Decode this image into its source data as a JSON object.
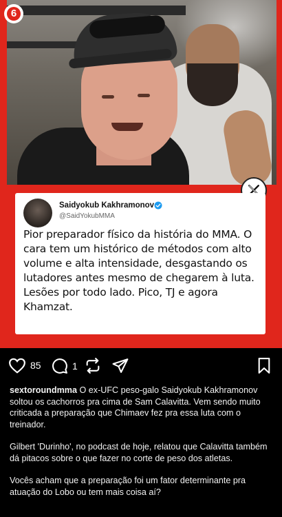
{
  "post": {
    "brand_logo_text": "6",
    "tweet": {
      "name": "Saidyokub Kakhramonov",
      "handle": "@SaidYokubMMA",
      "text": "Pior preparador físico da história do MMA. O cara tem um histórico de métodos com alto volume e alta intensidade, desgastando os lutadores antes mesmo de chegarem à luta. Lesões por todo lado. Pico, TJ e agora Khamzat."
    }
  },
  "actions": {
    "like_count": "85",
    "comment_count": "1"
  },
  "caption": {
    "username": "sextoroundmma",
    "paragraph_1": "O ex-UFC peso-galo Saidyokub Kakhramonov soltou os cachorros pra cima de Sam Calavitta. Vem sendo muito criticada a preparação que Chimaev fez pra essa luta com o treinador.",
    "paragraph_2": "Gilbert 'Durinho', no podcast de hoje, relatou que Calavitta também dá pitacos sobre o que fazer no corte de peso dos atletas.",
    "paragraph_3": "Vocês acham que a preparação foi um fator determinante pra atuação do Lobo ou tem mais coisa aí?"
  },
  "colors": {
    "frame_red": "#e0261c",
    "background": "#000000",
    "verified_blue": "#1d9bf0"
  },
  "icons": [
    "heart-icon",
    "comment-icon",
    "repost-icon",
    "share-icon",
    "bookmark-icon",
    "x-logo-icon",
    "verified-icon"
  ]
}
